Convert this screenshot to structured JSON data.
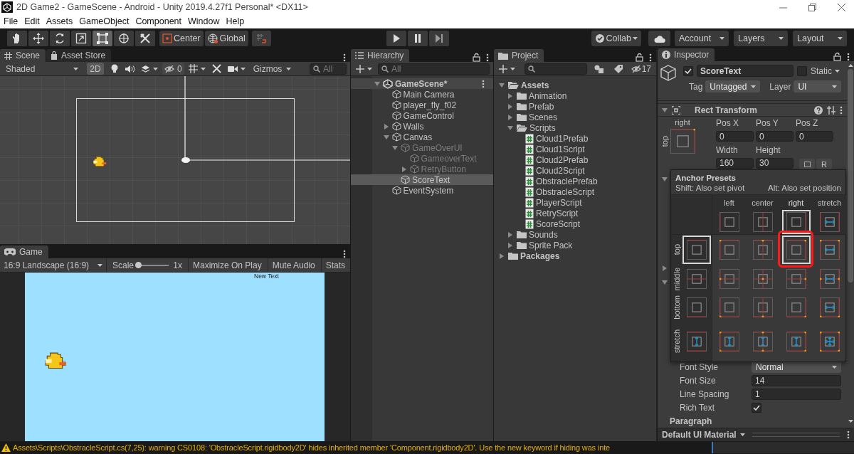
{
  "window": {
    "title": "2D Game2 - GameScene - Android - Unity 2019.4.27f1 Personal* <DX11>"
  },
  "menu": [
    "File",
    "Edit",
    "Assets",
    "GameObject",
    "Component",
    "Window",
    "Help"
  ],
  "toolbar": {
    "tools": [
      {
        "kind": "hand",
        "selected": false
      },
      {
        "kind": "move",
        "selected": false
      },
      {
        "kind": "rotate",
        "selected": false
      },
      {
        "kind": "scale",
        "selected": false
      },
      {
        "kind": "rect",
        "selected": true
      },
      {
        "kind": "transform",
        "selected": false
      },
      {
        "kind": "custom",
        "selected": false
      }
    ],
    "pivot": "Center",
    "space": "Global",
    "collab": "Collab",
    "account": "Account",
    "layers": "Layers",
    "layout": "Layout"
  },
  "scene": {
    "tabs": [
      {
        "label": "Scene",
        "selected": true
      },
      {
        "label": "Asset Store",
        "selected": false
      }
    ],
    "shading": "Shaded",
    "mode_2d": {
      "label": "2D",
      "on": true
    },
    "hidden_count": "0",
    "gizmos": "Gizmos",
    "search": {
      "placeholder": "All"
    }
  },
  "game": {
    "tab": "Game",
    "aspect": "16:9 Landscape (16:9)",
    "scale": {
      "label": "Scale",
      "level": 0,
      "reading": "1x"
    },
    "buttons": [
      "Maximize On Play",
      "Mute Audio",
      "Stats"
    ],
    "screen_text": "New Text"
  },
  "hierarchy": {
    "title": "Hierarchy",
    "search": {
      "placeholder": "All"
    },
    "items": [
      {
        "label": "GameScene*",
        "kind": "scene",
        "expanded": true,
        "selected": false,
        "active": true,
        "children": [
          {
            "label": "Main Camera",
            "kind": "object",
            "selected": false,
            "active": true
          },
          {
            "label": "player_fly_f02",
            "kind": "object",
            "selected": false,
            "active": true
          },
          {
            "label": "GameControl",
            "kind": "object",
            "selected": false,
            "active": true
          },
          {
            "label": "Walls",
            "kind": "object",
            "expanded": false,
            "selected": false,
            "active": true
          },
          {
            "label": "Canvas",
            "kind": "object",
            "expanded": true,
            "selected": false,
            "active": true,
            "children": [
              {
                "label": "GameOverUI",
                "kind": "object",
                "expanded": true,
                "selected": false,
                "active": false,
                "children": [
                  {
                    "label": "GameoverText",
                    "kind": "object",
                    "selected": false,
                    "active": false
                  },
                  {
                    "label": "RetryButton",
                    "kind": "object",
                    "expanded": false,
                    "selected": false,
                    "active": false
                  }
                ]
              },
              {
                "label": "ScoreText",
                "kind": "object",
                "selected": true,
                "active": true
              }
            ]
          },
          {
            "label": "EventSystem",
            "kind": "object",
            "selected": false,
            "active": true
          }
        ]
      }
    ]
  },
  "project": {
    "title": "Project",
    "hidden_count": "17",
    "items": [
      {
        "label": "Assets",
        "kind": "folder",
        "expanded": true,
        "children": [
          {
            "label": "Animation",
            "kind": "folder",
            "expanded": false
          },
          {
            "label": "Prefab",
            "kind": "folder",
            "expanded": false
          },
          {
            "label": "Scenes",
            "kind": "folder",
            "expanded": false
          },
          {
            "label": "Scripts",
            "kind": "folder",
            "expanded": true,
            "children": [
              {
                "label": "Cloud1Prefab",
                "kind": "script"
              },
              {
                "label": "Cloud1Script",
                "kind": "script"
              },
              {
                "label": "Cloud2Prefab",
                "kind": "script"
              },
              {
                "label": "Cloud2Script",
                "kind": "script"
              },
              {
                "label": "ObstraclePrefab",
                "kind": "script"
              },
              {
                "label": "ObstracleScript",
                "kind": "script"
              },
              {
                "label": "PlayerScript",
                "kind": "script"
              },
              {
                "label": "RetryScript",
                "kind": "script"
              },
              {
                "label": "ScoreScript",
                "kind": "script"
              }
            ]
          },
          {
            "label": "Sounds",
            "kind": "folder",
            "expanded": false
          },
          {
            "label": "Sprite Pack",
            "kind": "folder",
            "expanded": false
          }
        ]
      },
      {
        "label": "Packages",
        "kind": "folder",
        "expanded": false
      }
    ]
  },
  "inspector": {
    "title": "Inspector",
    "object": {
      "active": true,
      "name": "ScoreText",
      "static": {
        "label": "Static",
        "checked": false
      },
      "tag_label": "Tag",
      "tag": "Untagged",
      "layer_label": "Layer",
      "layer": "UI"
    },
    "rect_transform": {
      "title": "Rect Transform",
      "anchor_h": "right",
      "anchor_v": "top",
      "fields": [
        {
          "label": "Pos X",
          "value": "0"
        },
        {
          "label": "Pos Y",
          "value": "0"
        },
        {
          "label": "Pos Z",
          "value": "0"
        }
      ],
      "size_fields": [
        {
          "label": "Width",
          "value": "160"
        },
        {
          "label": "Height",
          "value": "30"
        }
      ],
      "raw_button": "R"
    },
    "text_fields": [
      {
        "kind": "dropdown",
        "label": "Font Style",
        "value": "Normal"
      },
      {
        "kind": "number",
        "label": "Font Size",
        "value": "14"
      },
      {
        "kind": "number",
        "label": "Line Spacing",
        "value": "1"
      },
      {
        "kind": "checkbox",
        "label": "Rich Text",
        "checked": true
      }
    ],
    "section": "Paragraph",
    "material": "Default UI Material"
  },
  "anchor_presets": {
    "title": "Anchor Presets",
    "hint_left": "Shift: Also set pivot",
    "hint_right": "Alt: Also set position",
    "columns": [
      {
        "label": "left",
        "selected": false
      },
      {
        "label": "center",
        "selected": false
      },
      {
        "label": "right",
        "selected": true
      },
      {
        "label": "stretch",
        "selected": false
      }
    ],
    "rows": [
      {
        "label": "top",
        "selected": true
      },
      {
        "label": "middle",
        "selected": false
      },
      {
        "label": "bottom",
        "selected": false
      },
      {
        "label": "stretch",
        "selected": false
      }
    ]
  },
  "status_bar": {
    "message": "Assets\\Scripts\\ObstracleScript.cs(7,25): warning CS0108: 'ObstracleScript.rigidbody2D' hides inherited member 'Component.rigidbody2D'. Use the new keyword if hiding was inte"
  }
}
